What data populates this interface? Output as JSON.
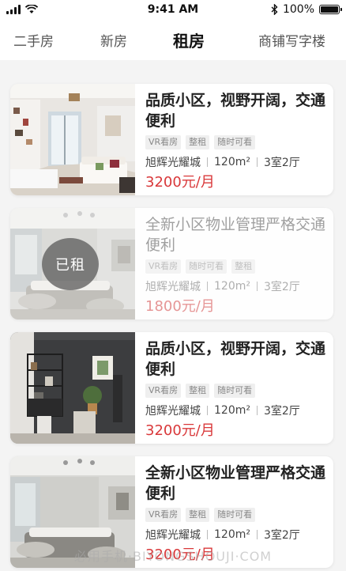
{
  "status_bar": {
    "time": "9:41 AM",
    "battery": "100%",
    "battery_level": 1.0
  },
  "tabs": [
    {
      "label": "二手房",
      "active": false
    },
    {
      "label": "新房",
      "active": false
    },
    {
      "label": "租房",
      "active": true
    },
    {
      "label": "商铺写字楼",
      "active": false
    }
  ],
  "listings": [
    {
      "title": "品质小区，视野开阔，交通便利",
      "tags": [
        "VR看房",
        "整租",
        "随时可看"
      ],
      "community": "旭辉光耀城",
      "area": "120m²",
      "layout": "3室2厅",
      "price": "3200元/月",
      "rented": false,
      "badge": ""
    },
    {
      "title": "全新小区物业管理严格交通便利",
      "tags": [
        "VR看房",
        "随时可看",
        "整租"
      ],
      "community": "旭辉光耀城",
      "area": "120m²",
      "layout": "3室2厅",
      "price": "1800元/月",
      "rented": true,
      "badge": "已租"
    },
    {
      "title": "品质小区，视野开阔，交通便利",
      "tags": [
        "VR看房",
        "整租",
        "随时可看"
      ],
      "community": "旭辉光耀城",
      "area": "120m²",
      "layout": "3室2厅",
      "price": "3200元/月",
      "rented": false,
      "badge": ""
    },
    {
      "title": "全新小区物业管理严格交通便利",
      "tags": [
        "VR看房",
        "整租",
        "随时可看"
      ],
      "community": "旭辉光耀城",
      "area": "120m²",
      "layout": "3室2厅",
      "price": "3200元/月",
      "rented": false,
      "badge": ""
    }
  ],
  "watermark": "必用手机·BIYONGSHOUJI·COM",
  "colors": {
    "price": "#d9383a",
    "active_tab": "#111111",
    "tab": "#555555"
  }
}
